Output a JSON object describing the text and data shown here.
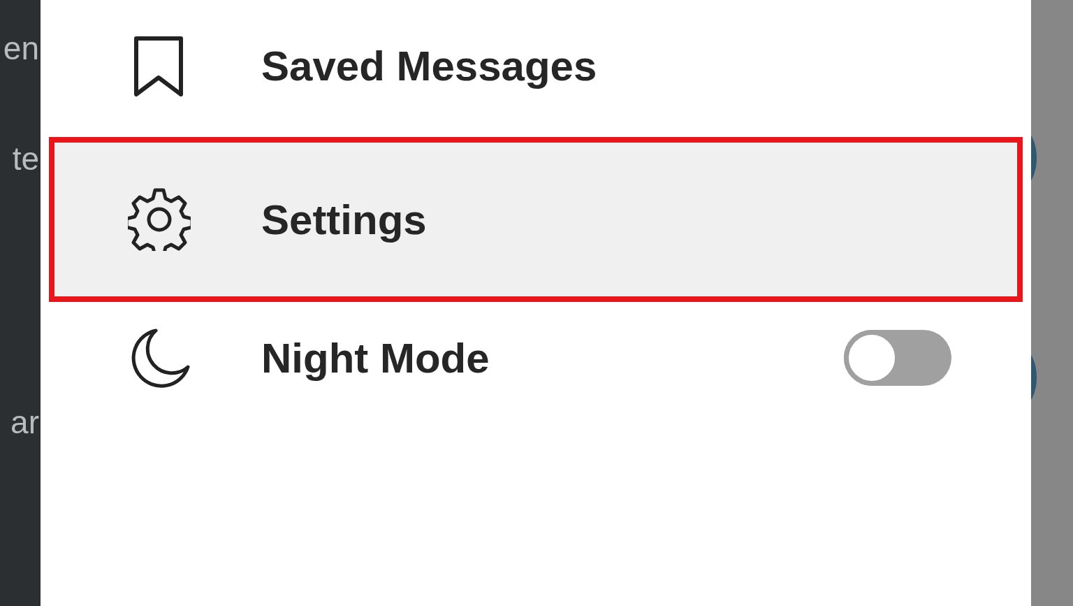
{
  "behind_left": [
    "en",
    "te",
    "ar"
  ],
  "menu": {
    "items": [
      {
        "label": "Saved Messages",
        "kind": "link",
        "highlighted": false
      },
      {
        "label": "Settings",
        "kind": "link",
        "highlighted": true
      },
      {
        "label": "Night Mode",
        "kind": "toggle",
        "on": false,
        "highlighted": false
      }
    ]
  }
}
